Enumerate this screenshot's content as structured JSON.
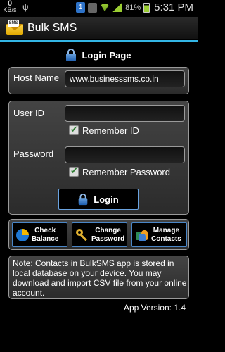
{
  "status_bar": {
    "data_rate_value": "0",
    "data_rate_unit": "KB/s",
    "sim_badge": "1",
    "battery_percent": "81%",
    "time": "5:31 PM"
  },
  "app": {
    "title": "Bulk SMS",
    "logo_text": "SMS"
  },
  "page": {
    "title": "Login Page"
  },
  "host": {
    "label": "Host Name",
    "value": "www.businesssms.co.in"
  },
  "credentials": {
    "user_id_label": "User ID",
    "user_id_value": "",
    "remember_id_label": "Remember ID",
    "remember_id_checked": true,
    "password_label": "Password",
    "password_value": "",
    "remember_password_label": "Remember Password",
    "remember_password_checked": true
  },
  "login_button": {
    "label": "Login"
  },
  "actions": {
    "check_balance_line1": "Check",
    "check_balance_line2": "Balance",
    "change_password_line1": "Change",
    "change_password_line2": "Password",
    "manage_contacts_line1": "Manage",
    "manage_contacts_line2": "Contacts"
  },
  "note": {
    "text": "Note: Contacts in BulkSMS app is stored in local database on your device. You may download and import CSV file from your online account."
  },
  "footer": {
    "version": "App Version: 1.4"
  },
  "colors": {
    "accent_blue": "#33b5e5",
    "button_border": "#4a86c7",
    "panel_border": "#9a9a9a"
  }
}
